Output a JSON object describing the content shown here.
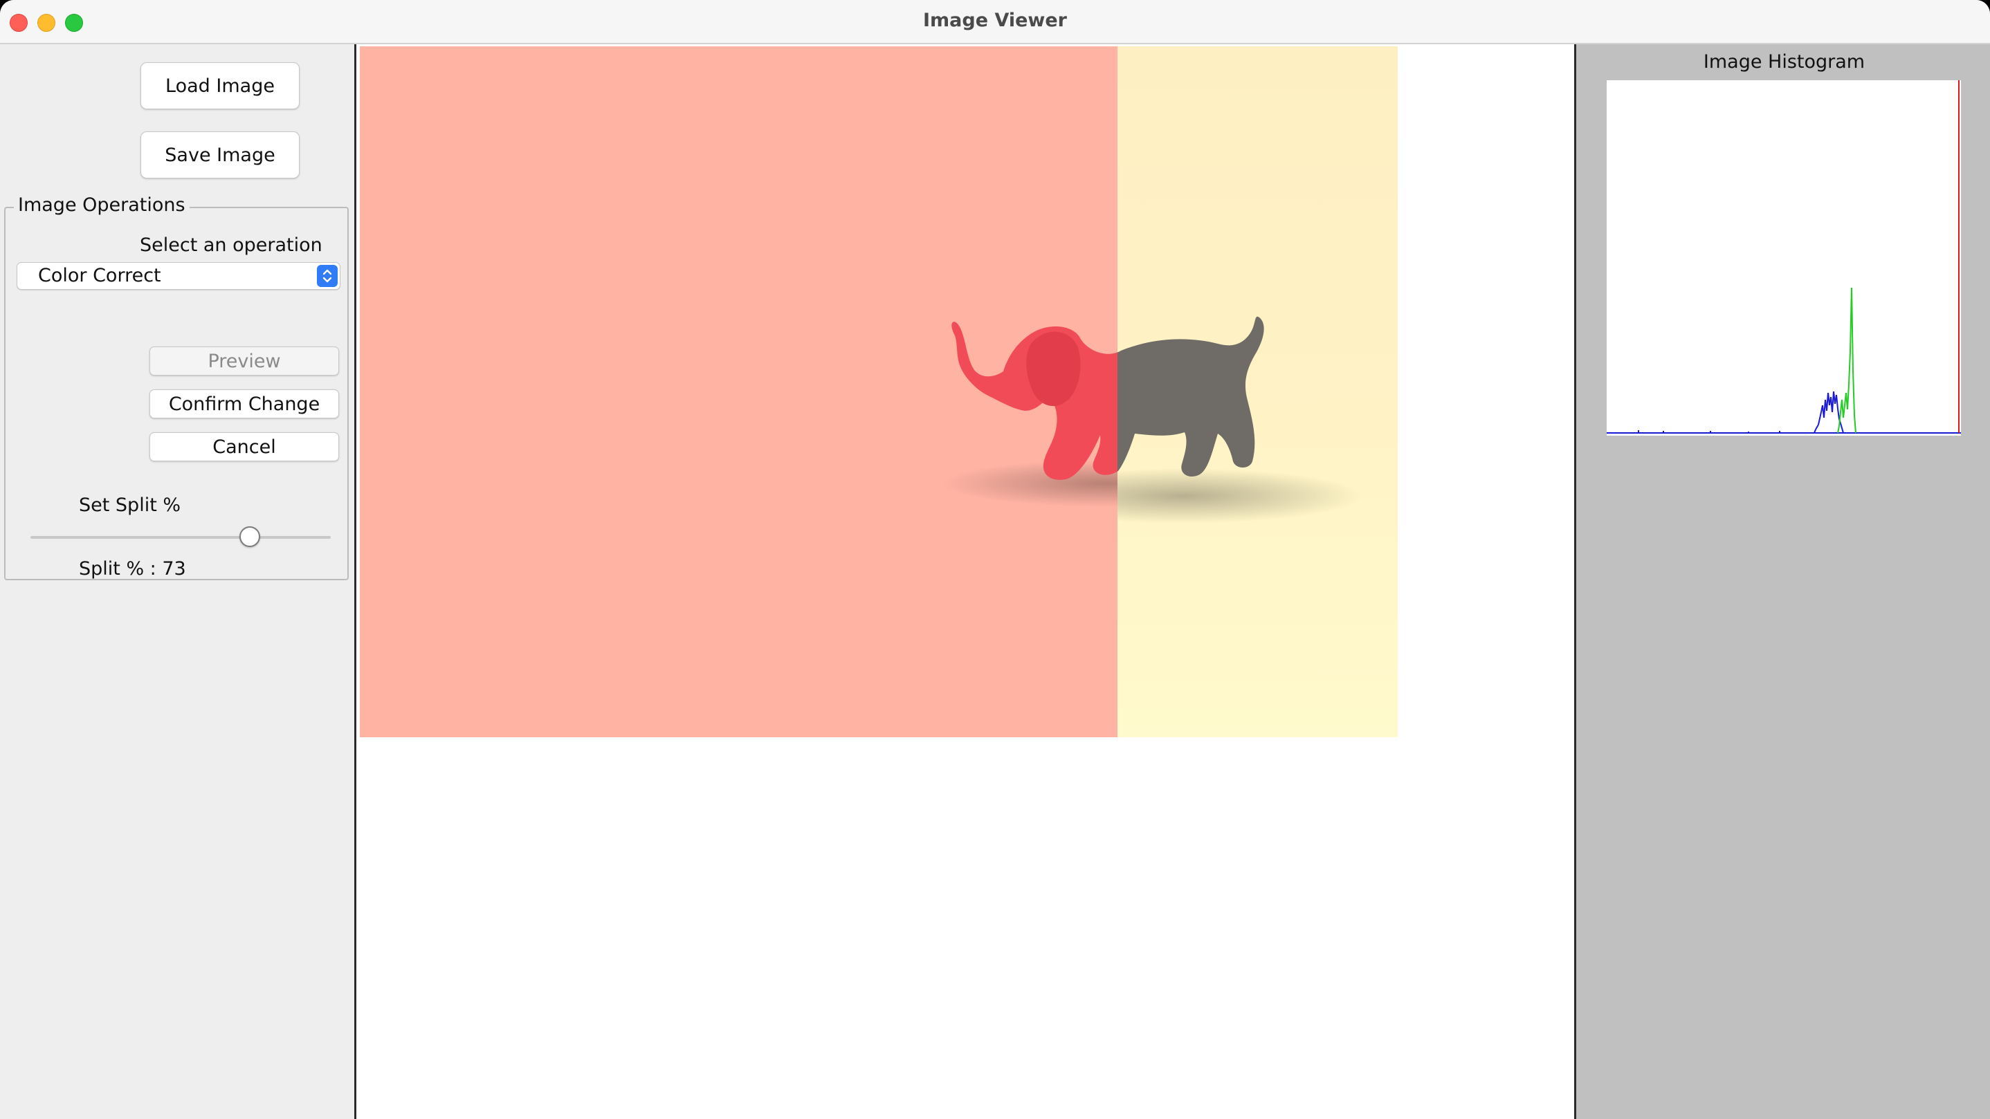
{
  "window": {
    "title": "Image Viewer"
  },
  "left_panel": {
    "load_button": "Load Image",
    "save_button": "Save Image",
    "operations_group_title": "Image Operations",
    "select_label": "Select an operation",
    "selected_operation": "Color Correct",
    "preview_button": "Preview",
    "preview_enabled": false,
    "confirm_button": "Confirm Change",
    "cancel_button": "Cancel",
    "split_label": "Set Split %",
    "split_value_text": "Split % : 73",
    "split_percent": 73
  },
  "image": {
    "left_tint": "#ffb3a3",
    "right_tint": "#fff3c6",
    "elephant_left_color": "#f24b58",
    "elephant_right_color": "#6f6b66"
  },
  "histogram": {
    "title": "Image Histogram",
    "colors": {
      "red": "#e0161b",
      "green": "#22cc22",
      "blue": "#1a1ad6"
    },
    "axis_color": "#1a1ad6"
  }
}
